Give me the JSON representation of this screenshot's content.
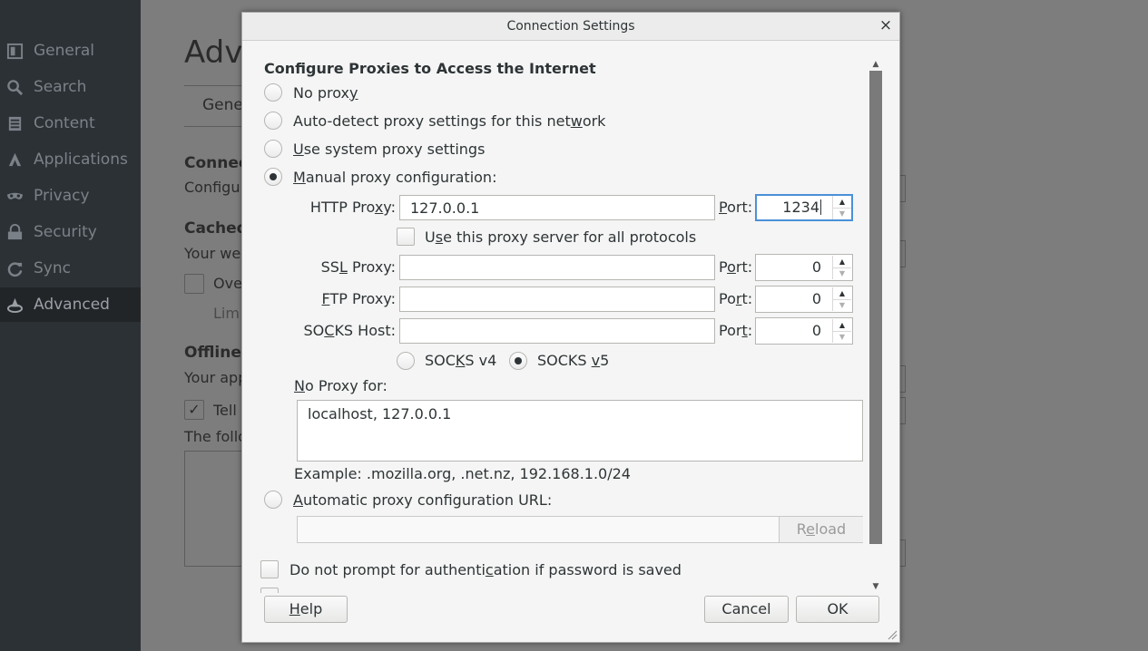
{
  "sidebar": {
    "items": [
      {
        "label": "General",
        "icon": "general-icon"
      },
      {
        "label": "Search",
        "icon": "search-icon"
      },
      {
        "label": "Content",
        "icon": "content-icon"
      },
      {
        "label": "Applications",
        "icon": "applications-icon"
      },
      {
        "label": "Privacy",
        "icon": "privacy-mask-icon"
      },
      {
        "label": "Security",
        "icon": "security-lock-icon"
      },
      {
        "label": "Sync",
        "icon": "sync-icon"
      },
      {
        "label": "Advanced",
        "icon": "advanced-wizard-icon",
        "active": true
      }
    ]
  },
  "background": {
    "page_title": "Adva",
    "tab_general": "Gene",
    "connection_heading": "Connec",
    "connection_desc": "Configu",
    "cached_heading": "Cached",
    "cached_desc": "Your we",
    "override_label": "Ove",
    "limit_label": "Lim",
    "offline_heading": "Offline",
    "offline_desc": "Your app",
    "tell_label": "Tell",
    "following_label": "The follo"
  },
  "dialog": {
    "title": "Connection Settings",
    "close_glyph": "×",
    "section_heading": "Configure Proxies to Access the Internet",
    "options": {
      "no_proxy": {
        "pre": "No prox",
        "key": "y",
        "post": ""
      },
      "auto_detect": {
        "pre": "Auto-detect proxy settings for this net",
        "key": "w",
        "post": "ork"
      },
      "system": {
        "pre": "",
        "key": "U",
        "post": "se system proxy settings"
      },
      "manual": {
        "pre": "",
        "key": "M",
        "post": "anual proxy configuration:"
      },
      "auto_url": {
        "pre": "",
        "key": "A",
        "post": "utomatic proxy configuration URL:"
      }
    },
    "selected_option": "manual",
    "http": {
      "label_pre": "HTTP Pro",
      "label_key": "x",
      "label_post": "y:",
      "value": "127.0.0.1",
      "port_pre": "",
      "port_key": "P",
      "port_post": "ort:",
      "port": "1234"
    },
    "use_all": {
      "pre": "U",
      "key": "s",
      "post": "e this proxy server for all protocols"
    },
    "ssl": {
      "label_pre": "SS",
      "label_key": "L",
      "label_post": " Proxy:",
      "value": "",
      "port_pre": "P",
      "port_key": "o",
      "port_post": "rt:",
      "port": "0"
    },
    "ftp": {
      "label_pre": "",
      "label_key": "F",
      "label_post": "TP Proxy:",
      "value": "",
      "port_pre": "Po",
      "port_key": "r",
      "port_post": "t:",
      "port": "0"
    },
    "socks": {
      "label_pre": "SO",
      "label_key": "C",
      "label_post": "KS Host:",
      "value": "",
      "port_pre": "Por",
      "port_key": "t",
      "port_post": ":",
      "port": "0"
    },
    "socks_v4": {
      "pre": "SOC",
      "key": "K",
      "post": "S v4"
    },
    "socks_v5": {
      "pre": "SOCKS ",
      "key": "v",
      "post": "5"
    },
    "socks_version": "v5",
    "no_proxy_for": {
      "pre": "",
      "key": "N",
      "post": "o Proxy for:",
      "value": "localhost, 127.0.0.1"
    },
    "example": "Example: .mozilla.org, .net.nz, 192.168.1.0/24",
    "pac_url": "",
    "reload": {
      "pre": "R",
      "key": "e",
      "post": "load"
    },
    "no_prompt_auth": {
      "pre": "Do not prompt for authenti",
      "key": "c",
      "post": "ation if password is saved"
    },
    "help": {
      "pre": "",
      "key": "H",
      "post": "elp"
    },
    "cancel": "Cancel",
    "ok": "OK"
  }
}
